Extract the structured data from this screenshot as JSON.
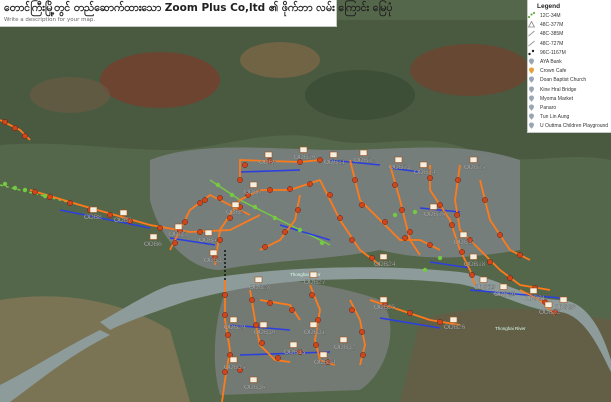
{
  "map": {
    "title": "တောင်ကြီးမြို့တွင် တည်ဆောက်ထားသော Zoom Plus Co,ltd ၏ ဖိုက်ဘာ လမ်း ကြောင်း မြေပုံ",
    "description": "Write a description for your map.",
    "river_labels": [
      "Thonghai River",
      "Thonghai River"
    ]
  },
  "legend": {
    "title": "Legend",
    "items": [
      {
        "label": "12C-34M",
        "icon": "green-dot-line-icon",
        "color": "#6ab04c"
      },
      {
        "label": "48C-377M",
        "icon": "triangle-icon",
        "color": "#888888"
      },
      {
        "label": "48C-385M",
        "icon": "line-icon",
        "color": "#999999"
      },
      {
        "label": "48C-727M",
        "icon": "line-icon",
        "color": "#999999"
      },
      {
        "label": "96C-1167M",
        "icon": "black-dots-icon",
        "color": "#222222"
      },
      {
        "label": "AYA Bank",
        "icon": "pin-icon",
        "color": "#9aa5b5"
      },
      {
        "label": "Crown Cafe",
        "icon": "pin-icon",
        "color": "#e8a03a"
      },
      {
        "label": "Doan Baptist Church",
        "icon": "pin-icon",
        "color": "#9aa5b5"
      },
      {
        "label": "Kine Hral Bridge",
        "icon": "pin-icon",
        "color": "#9aa5b5"
      },
      {
        "label": "Myoma Market",
        "icon": "pin-icon",
        "color": "#9aa5b5"
      },
      {
        "label": "Panaro",
        "icon": "pin-icon",
        "color": "#9aa5b5"
      },
      {
        "label": "Tun Lin Aung",
        "icon": "pin-icon",
        "color": "#9aa5b5"
      },
      {
        "label": "U Outtma Children Playground",
        "icon": "pin-icon",
        "color": "#9aa5b5"
      }
    ]
  },
  "odb_labels": [
    "ODB8",
    "ODB7",
    "ODB6",
    "ODB5",
    "ODB4",
    "ODB3",
    "ODB2",
    "ODB1",
    "ODB9",
    "ODB10",
    "ODB11",
    "ODB12",
    "ODB13",
    "ODB14",
    "ODB15",
    "ODB16",
    "ODB17",
    "ODB18",
    "ODB19",
    "ODB20",
    "ODB21",
    "ODB22",
    "ODB23",
    "ODB24",
    "ODB25",
    "ODB26",
    "ODB27",
    "ODB28",
    "ODB29",
    "ODB30",
    "ODB31",
    "ODB32",
    "ODB33",
    "ODB34",
    "ODB35",
    "ODB36"
  ],
  "colors": {
    "fiber_orange": "#ff7a1a",
    "fiber_blue": "#2b3fe0",
    "closure_dot": "#d0461c",
    "green_line": "#76c943",
    "river": "#7d8e8e",
    "land": "#5a6a4a"
  }
}
